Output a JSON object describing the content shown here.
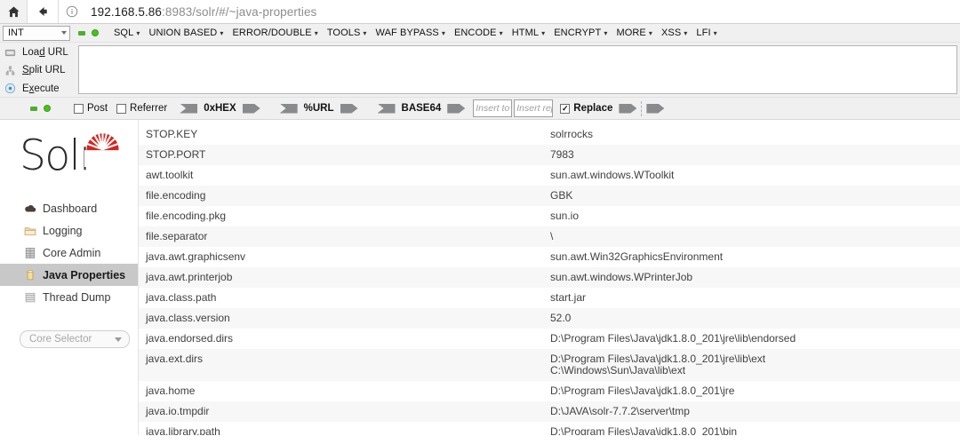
{
  "browser": {
    "home_icon": "home-icon",
    "back_icon": "back-arrow-icon",
    "info_icon": "info-circle-icon",
    "url_host": "192.168.5.86",
    "url_rest": ":8983/solr/#/~java-properties",
    "url_full": "192.168.5.86:8983/solr/#/~java-properties"
  },
  "hackbar": {
    "mode_select": "INT",
    "indicator_square": "green-square-indicator",
    "indicator_circle": "green-circle-indicator",
    "menus": [
      {
        "label": "SQL"
      },
      {
        "label": "UNION BASED"
      },
      {
        "label": "ERROR/DOUBLE"
      },
      {
        "label": "TOOLS"
      },
      {
        "label": "WAF BYPASS"
      },
      {
        "label": "ENCODE"
      },
      {
        "label": "HTML"
      },
      {
        "label": "ENCRYPT"
      },
      {
        "label": "MORE"
      },
      {
        "label": "XSS"
      },
      {
        "label": "LFI"
      }
    ],
    "actions": [
      {
        "label": "Load URL",
        "accel": "d",
        "icon": "load-url-icon"
      },
      {
        "label": "Split URL",
        "accel": "S",
        "icon": "split-url-icon"
      },
      {
        "label": "Execute",
        "accel": "x",
        "icon": "execute-icon"
      }
    ],
    "textarea_value": "",
    "options": {
      "post_label": "Post",
      "post_checked": false,
      "referrer_label": "Referrer",
      "referrer_checked": false,
      "encoders": [
        {
          "label": "0xHEX"
        },
        {
          "label": "%URL"
        },
        {
          "label": "BASE64"
        }
      ],
      "insert_to_placeholder": "Insert to r",
      "insert_to_value": "",
      "insert_replace_placeholder": "Insert rep",
      "insert_replace_value": "",
      "replace_label": "Replace",
      "replace_checked": true
    }
  },
  "solr": {
    "logo_text": "Solr",
    "logo_accent": "#D9241F",
    "nav": [
      {
        "label": "Dashboard",
        "icon": "cloud-icon",
        "active": false
      },
      {
        "label": "Logging",
        "icon": "folder-icon",
        "active": false
      },
      {
        "label": "Core Admin",
        "icon": "grid-icon",
        "active": false
      },
      {
        "label": "Java Properties",
        "icon": "cylinder-icon",
        "active": true
      },
      {
        "label": "Thread Dump",
        "icon": "stack-icon",
        "active": false
      }
    ],
    "core_selector": {
      "label": "Core Selector",
      "caret_icon": "chevron-down-icon"
    },
    "properties": [
      {
        "key": "STOP.KEY",
        "value": [
          "solrrocks"
        ]
      },
      {
        "key": "STOP.PORT",
        "value": [
          "7983"
        ]
      },
      {
        "key": "awt.toolkit",
        "value": [
          "sun.awt.windows.WToolkit"
        ]
      },
      {
        "key": "file.encoding",
        "value": [
          "GBK"
        ]
      },
      {
        "key": "file.encoding.pkg",
        "value": [
          "sun.io"
        ]
      },
      {
        "key": "file.separator",
        "value": [
          "\\"
        ]
      },
      {
        "key": "java.awt.graphicsenv",
        "value": [
          "sun.awt.Win32GraphicsEnvironment"
        ]
      },
      {
        "key": "java.awt.printerjob",
        "value": [
          "sun.awt.windows.WPrinterJob"
        ]
      },
      {
        "key": "java.class.path",
        "value": [
          "start.jar"
        ]
      },
      {
        "key": "java.class.version",
        "value": [
          "52.0"
        ]
      },
      {
        "key": "java.endorsed.dirs",
        "value": [
          "D:\\Program Files\\Java\\jdk1.8.0_201\\jre\\lib\\endorsed"
        ]
      },
      {
        "key": "java.ext.dirs",
        "value": [
          "D:\\Program Files\\Java\\jdk1.8.0_201\\jre\\lib\\ext",
          "C:\\Windows\\Sun\\Java\\lib\\ext"
        ]
      },
      {
        "key": "java.home",
        "value": [
          "D:\\Program Files\\Java\\jdk1.8.0_201\\jre"
        ]
      },
      {
        "key": "java.io.tmpdir",
        "value": [
          "D:\\JAVA\\solr-7.7.2\\server\\tmp"
        ]
      },
      {
        "key": "java.library.path",
        "value": [
          "D:\\Program Files\\Java\\jdk1.8.0_201\\bin"
        ]
      }
    ]
  }
}
